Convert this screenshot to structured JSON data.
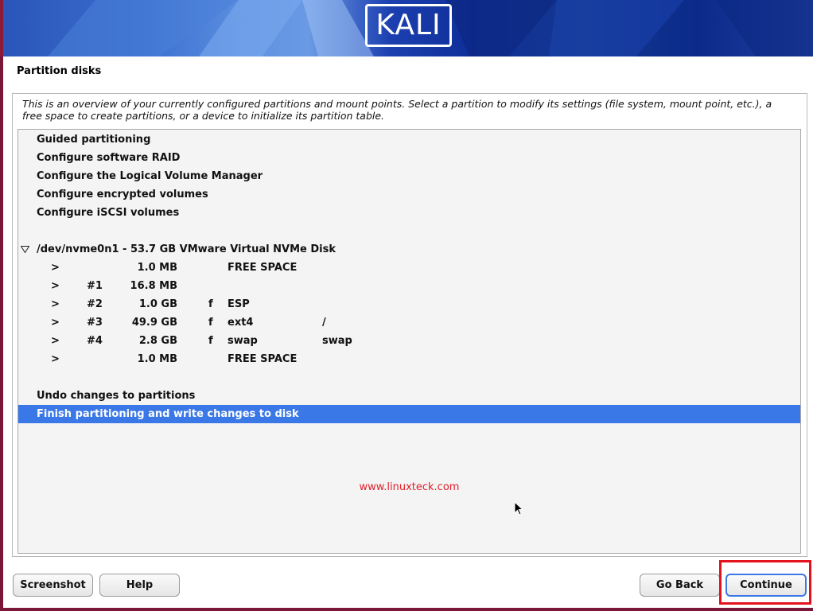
{
  "banner": {
    "logo_text": "KALI"
  },
  "page": {
    "title": "Partition disks",
    "description": "This is an overview of your currently configured partitions and mount points. Select a partition to modify its settings (file system, mount point, etc.), a free space to create partitions, or a device to initialize its partition table."
  },
  "menu": {
    "guided": "Guided partitioning",
    "raid": "Configure software RAID",
    "lvm": "Configure the Logical Volume Manager",
    "encrypted": "Configure encrypted volumes",
    "iscsi": "Configure iSCSI volumes",
    "undo": "Undo changes to partitions",
    "finish": "Finish partitioning and write changes to disk"
  },
  "disk": {
    "label": "/dev/nvme0n1 - 53.7 GB VMware Virtual NVMe Disk",
    "partitions": [
      {
        "arrow": ">",
        "number": "",
        "size": "1.0 MB",
        "flag": "",
        "fs": "FREE SPACE",
        "mount": ""
      },
      {
        "arrow": ">",
        "number": "#1",
        "size": "16.8 MB",
        "flag": "",
        "fs": "",
        "mount": ""
      },
      {
        "arrow": ">",
        "number": "#2",
        "size": "1.0 GB",
        "flag": "f",
        "fs": "ESP",
        "mount": ""
      },
      {
        "arrow": ">",
        "number": "#3",
        "size": "49.9 GB",
        "flag": "f",
        "fs": "ext4",
        "mount": "/"
      },
      {
        "arrow": ">",
        "number": "#4",
        "size": "2.8 GB",
        "flag": "f",
        "fs": "swap",
        "mount": "swap"
      },
      {
        "arrow": ">",
        "number": "",
        "size": "1.0 MB",
        "flag": "",
        "fs": "FREE SPACE",
        "mount": ""
      }
    ]
  },
  "watermark": "www.linuxteck.com",
  "buttons": {
    "screenshot": "Screenshot",
    "help": "Help",
    "go_back": "Go Back",
    "continue": "Continue"
  },
  "colors": {
    "selection": "#3b78e7",
    "highlight": "#e3121c",
    "watermark": "#e0202a"
  }
}
